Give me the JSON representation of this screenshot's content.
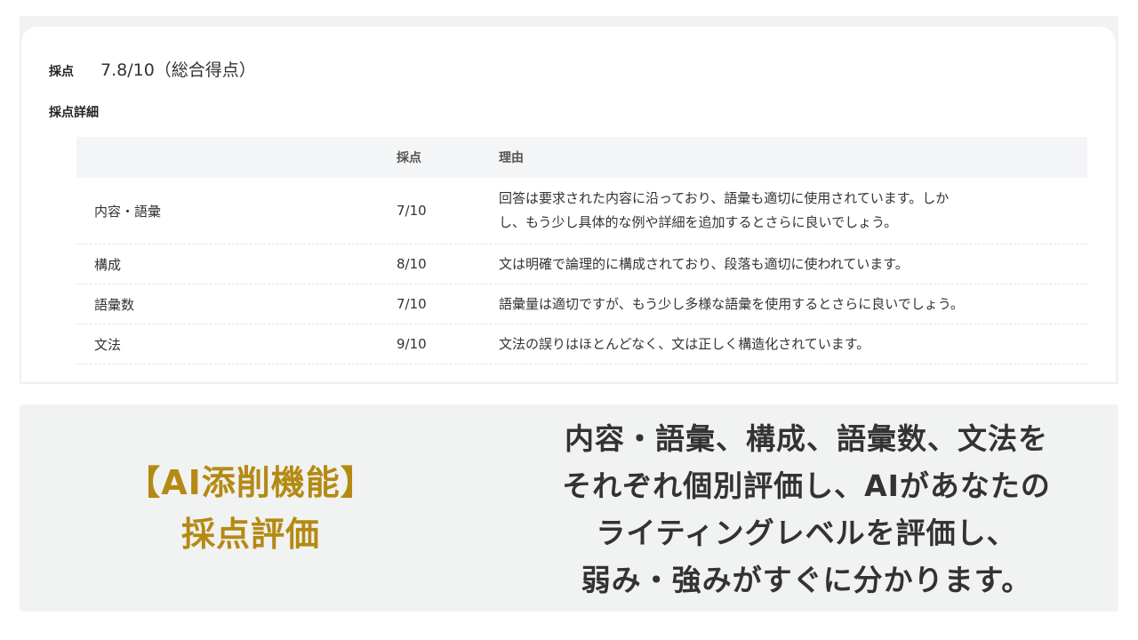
{
  "score": {
    "label": "採点",
    "value": "7.8/10（総合得点）"
  },
  "detail": {
    "title": "採点詳細",
    "columns": [
      "",
      "採点",
      "理由"
    ],
    "rows": [
      {
        "name": "内容・語彙",
        "score": "7/10",
        "reason_lines": [
          "回答は要求された内容に沿っており、語彙も適切に使用されています。しか",
          "し、もう少し具体的な例や詳細を追加するとさらに良いでしょう。"
        ]
      },
      {
        "name": "構成",
        "score": "8/10",
        "reason_lines": [
          "文は明確で論理的に構成されており、段落も適切に使われています。"
        ]
      },
      {
        "name": "語彙数",
        "score": "7/10",
        "reason_lines": [
          "語彙量は適切ですが、もう少し多様な語彙を使用するとさらに良いでしょう。"
        ]
      },
      {
        "name": "文法",
        "score": "9/10",
        "reason_lines": [
          "文法の誤りはほとんどなく、文は正しく構造化されています。"
        ]
      }
    ]
  },
  "banner": {
    "left_lines": [
      "【AI添削機能】",
      "採点評価"
    ],
    "right_lines": [
      "内容・語彙、構成、語彙数、文法を",
      "それぞれ個別評価し、AIがあなたの",
      "ライティングレベルを評価し、",
      "弱み・強みがすぐに分かります。"
    ],
    "accent_color": "#b48a12",
    "background_color": "#f1f2f2"
  }
}
